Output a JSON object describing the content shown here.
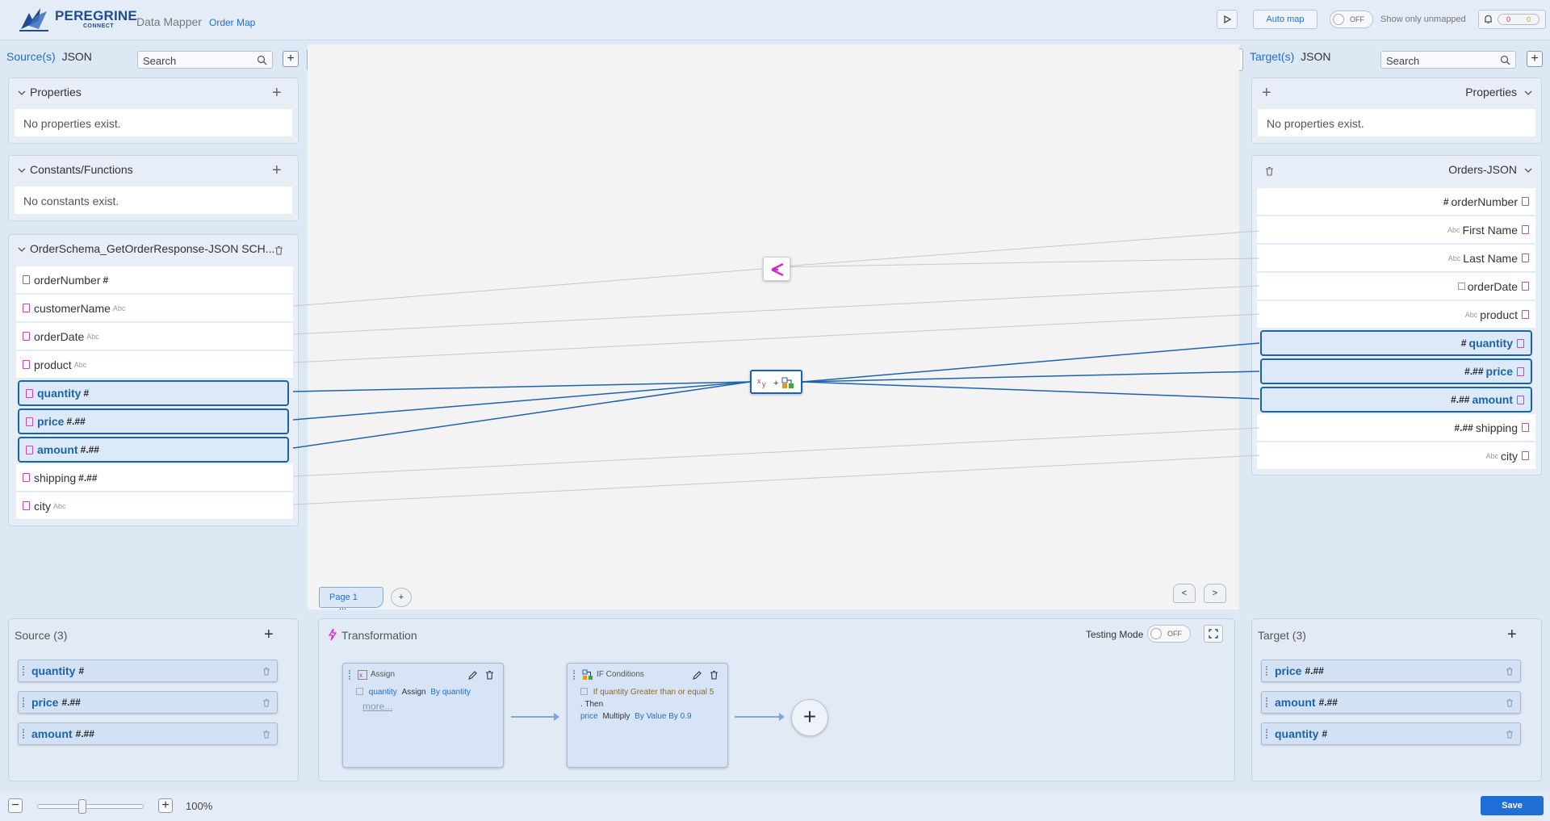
{
  "header": {
    "brand": "PEREGRINE",
    "brand_sub": "CONNECT",
    "app_name": "Data Mapper",
    "map_name": "Order Map",
    "auto_map_label": "Auto map",
    "toggle_off": "OFF",
    "show_unmapped_label": "Show only unmapped",
    "notif_count_a": "0",
    "notif_count_b": "0"
  },
  "source_panel": {
    "label": "Source(s)",
    "type": "JSON",
    "search_placeholder": "Search",
    "properties_title": "Properties",
    "properties_empty": "No properties exist.",
    "constants_title": "Constants/Functions",
    "constants_empty": "No constants exist.",
    "schema_title": "OrderSchema_GetOrderResponse-JSON SCH...",
    "fields": [
      {
        "name": "orderNumber",
        "type": "#"
      },
      {
        "name": "customerName",
        "type": "Abc"
      },
      {
        "name": "orderDate",
        "type": "Abc"
      },
      {
        "name": "product",
        "type": "Abc"
      },
      {
        "name": "quantity",
        "type": "#"
      },
      {
        "name": "price",
        "type": "#.##"
      },
      {
        "name": "amount",
        "type": "#.##"
      },
      {
        "name": "shipping",
        "type": "#.##"
      },
      {
        "name": "city",
        "type": "Abc"
      }
    ]
  },
  "target_panel": {
    "label": "Target(s)",
    "type": "JSON",
    "search_placeholder": "Search",
    "properties_title": "Properties",
    "properties_empty": "No properties exist.",
    "schema_title": "Orders-JSON",
    "fields": [
      {
        "name": "orderNumber",
        "type": "#"
      },
      {
        "name": "First Name",
        "type": "Abc"
      },
      {
        "name": "Last Name",
        "type": "Abc"
      },
      {
        "name": "orderDate",
        "type": ""
      },
      {
        "name": "product",
        "type": "Abc"
      },
      {
        "name": "quantity",
        "type": "#"
      },
      {
        "name": "price",
        "type": "#.##"
      },
      {
        "name": "amount",
        "type": "#.##"
      },
      {
        "name": "shipping",
        "type": "#.##"
      },
      {
        "name": "city",
        "type": "Abc"
      }
    ]
  },
  "canvas": {
    "page_tab": "Page 1",
    "page_tab_more": "...",
    "add_page": "+",
    "prev": "<",
    "next": ">"
  },
  "bottom_source": {
    "title": "Source (3)",
    "chips": [
      {
        "name": "quantity",
        "type": "#"
      },
      {
        "name": "price",
        "type": "#.##"
      },
      {
        "name": "amount",
        "type": "#.##"
      }
    ]
  },
  "transformation": {
    "title": "Transformation",
    "testing_mode_label": "Testing Mode",
    "testing_toggle": "OFF",
    "assign_card": {
      "title": "Assign",
      "field": "quantity",
      "op": "Assign",
      "by": "By quantity",
      "more": "more..."
    },
    "if_card": {
      "title": "IF Conditions",
      "cond": "If quantity Greater than or equal 5",
      "then": ". Then",
      "field": "price",
      "op": "Multiply",
      "by": "By Value By 0.9"
    }
  },
  "bottom_target": {
    "title": "Target (3)",
    "chips": [
      {
        "name": "price",
        "type": "#.##"
      },
      {
        "name": "amount",
        "type": "#.##"
      },
      {
        "name": "quantity",
        "type": "#"
      }
    ]
  },
  "footer": {
    "zoom": "100%",
    "zoom_level": 0.42,
    "minus": "−",
    "plus": "+",
    "save_label": "Save"
  },
  "colors": {
    "accent": "#1e6fd0",
    "mapped_border": "#1c63ae",
    "save": "#1f6fd6"
  }
}
